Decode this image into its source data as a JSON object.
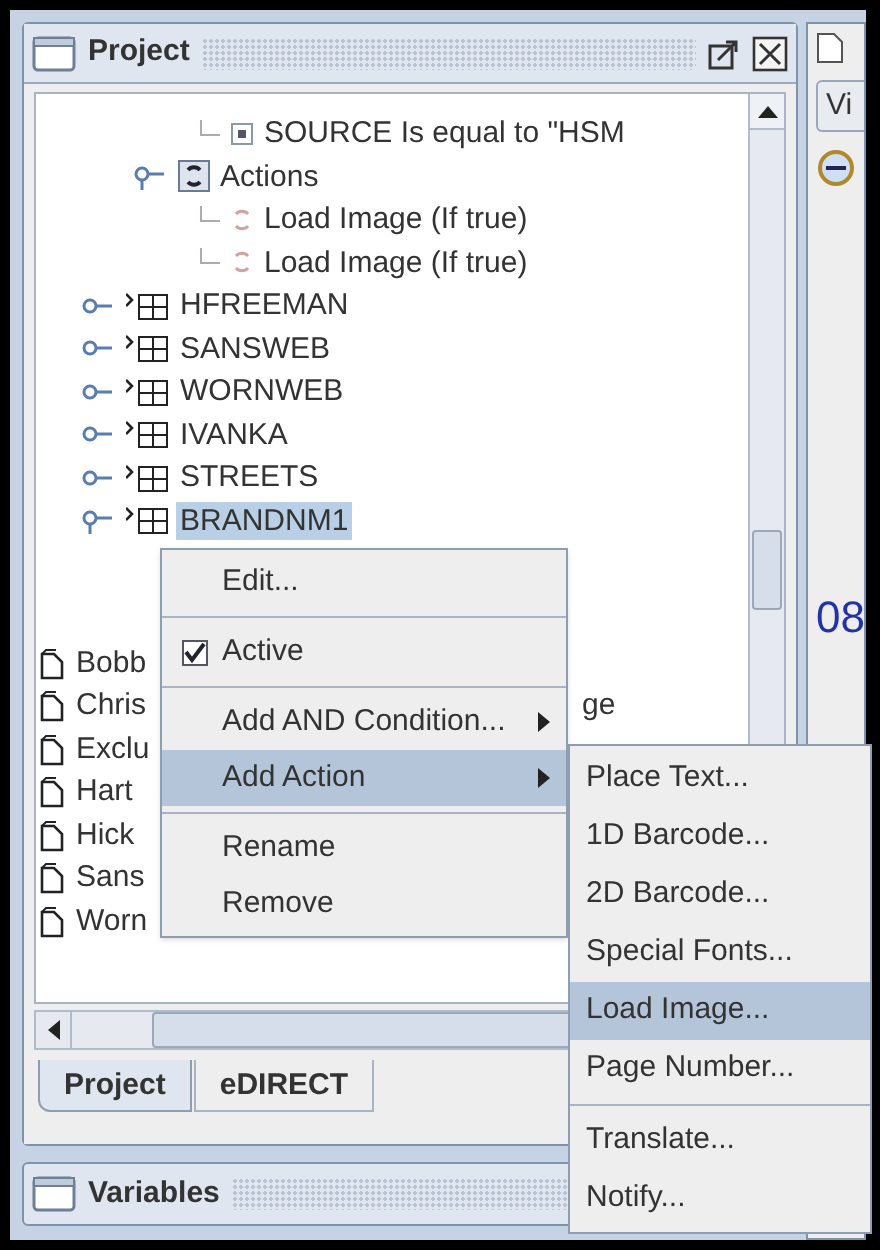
{
  "project_panel": {
    "title": "Project",
    "tree": [
      {
        "kind": "rule",
        "children": [
          {
            "kind": "conditions",
            "children": [
              {
                "kind": "condition",
                "label": "SOURCE Is equal to \"HSM"
              }
            ]
          },
          {
            "kind": "actions",
            "label": "Actions",
            "expanded": true,
            "children": [
              {
                "kind": "action",
                "label": "Load Image (If true)"
              },
              {
                "kind": "action",
                "label": "Load Image (If true)"
              }
            ]
          }
        ]
      },
      {
        "kind": "table",
        "label": "HFREEMAN",
        "expanded": false,
        "selected": false
      },
      {
        "kind": "table",
        "label": "SANSWEB",
        "expanded": false,
        "selected": false
      },
      {
        "kind": "table",
        "label": "WORNWEB",
        "expanded": false,
        "selected": false
      },
      {
        "kind": "table",
        "label": "IVANKA",
        "expanded": false,
        "selected": false
      },
      {
        "kind": "table",
        "label": "STREETS",
        "expanded": false,
        "selected": false
      },
      {
        "kind": "table",
        "label": "BRANDNM1",
        "expanded": true,
        "selected": true
      }
    ],
    "files": [
      {
        "label": "Bobb"
      },
      {
        "label": "Chris",
        "tail": "ge"
      },
      {
        "label": "Exclu"
      },
      {
        "label": "Hart"
      },
      {
        "label": "Hick"
      },
      {
        "label": "Sans"
      },
      {
        "label": "Worn"
      }
    ],
    "tabs": [
      {
        "label": "Project",
        "selected": true
      },
      {
        "label": "eDIRECT",
        "selected": false
      }
    ]
  },
  "variables_panel": {
    "title": "Variables"
  },
  "right_panel": {
    "button": "Vi",
    "text": "08"
  },
  "context_menu": {
    "items": [
      {
        "kind": "item",
        "label": "Edit...",
        "selected": false
      },
      {
        "kind": "separator"
      },
      {
        "kind": "check",
        "label": "Active",
        "checked": true,
        "selected": false
      },
      {
        "kind": "separator"
      },
      {
        "kind": "submenu",
        "label": "Add AND Condition...",
        "selected": false
      },
      {
        "kind": "submenu",
        "label": "Add Action",
        "selected": true
      },
      {
        "kind": "separator"
      },
      {
        "kind": "item",
        "label": "Rename",
        "selected": false
      },
      {
        "kind": "item",
        "label": "Remove",
        "selected": false
      }
    ]
  },
  "submenu": {
    "items": [
      {
        "kind": "item",
        "label": "Place Text...",
        "selected": false
      },
      {
        "kind": "item",
        "label": "1D Barcode...",
        "selected": false
      },
      {
        "kind": "item",
        "label": "2D Barcode...",
        "selected": false
      },
      {
        "kind": "item",
        "label": "Special Fonts...",
        "selected": false
      },
      {
        "kind": "item",
        "label": "Load Image...",
        "selected": true
      },
      {
        "kind": "item",
        "label": "Page Number...",
        "selected": false
      },
      {
        "kind": "separator"
      },
      {
        "kind": "item",
        "label": "Translate...",
        "selected": false
      },
      {
        "kind": "item",
        "label": "Notify...",
        "selected": false
      }
    ]
  }
}
